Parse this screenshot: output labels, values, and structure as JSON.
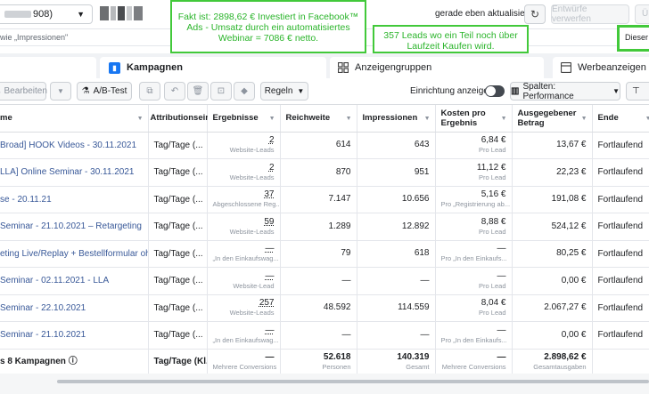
{
  "topbar": {
    "account_suffix": "908)",
    "status": "gerade eben aktualisiert",
    "discard_label": "Entwürfe verwerfen",
    "cut_label": "Ü"
  },
  "search": {
    "placeholder": "wie „Impressionen\""
  },
  "cut_right": "Dieser M",
  "annotations": {
    "a1": "Fakt ist: 2898,62 € Investiert in Facebook™ Ads - Umsatz durch ein automatisiertes Webinar = 7086 € netto.",
    "a2": "357 Leads wo ein Teil noch über Laufzeit Kaufen wird."
  },
  "tabs": {
    "campaigns": "Kampagnen",
    "adsets": "Anzeigengruppen",
    "ads": "Werbeanzeigen"
  },
  "toolbar": {
    "edit": "Bearbeiten",
    "ab_test": "A/B-Test",
    "rules": "Regeln",
    "setup": "Einrichtung anzeigen",
    "columns": "Spalten: Performance"
  },
  "colors": {
    "accent": "#1877f2",
    "annotation": "#42c93a",
    "link": "#385898"
  },
  "table": {
    "headers": {
      "name": "me",
      "attribution": "Attributionsein",
      "results": "Ergebnisse",
      "reach": "Reichweite",
      "impressions": "Impressionen",
      "cost": "Kosten pro Ergebnis",
      "spend": "Ausgegebener Betrag",
      "end": "Ende"
    },
    "rows": [
      {
        "name": "Broad] HOOK Videos - 30.11.2021",
        "attr": "Tag/Tage (...",
        "res": "2",
        "res_sub": "Website-Leads",
        "reach": "614",
        "impr": "643",
        "cost": "6,84 €",
        "cost_sub": "Pro Lead",
        "spend": "13,67 €",
        "end": "Fortlaufend"
      },
      {
        "name": "LLA] Online Seminar - 30.11.2021",
        "attr": "Tag/Tage (...",
        "res": "2",
        "res_sub": "Website-Leads",
        "reach": "870",
        "impr": "951",
        "cost": "11,12 €",
        "cost_sub": "Pro Lead",
        "spend": "22,23 €",
        "end": "Fortlaufend"
      },
      {
        "name": "se - 20.11.21",
        "attr": "Tag/Tage (...",
        "res": "37",
        "res_sub": "Abgeschlossene Reg...",
        "reach": "7.147",
        "impr": "10.656",
        "cost": "5,16 €",
        "cost_sub": "Pro „Registrierung ab...",
        "spend": "191,08 €",
        "end": "Fortlaufend"
      },
      {
        "name": "Seminar - 21.10.2021 – Retargeting",
        "attr": "Tag/Tage (...",
        "res": "59",
        "res_sub": "Website-Leads",
        "reach": "1.289",
        "impr": "12.892",
        "cost": "8,88 €",
        "cost_sub": "Pro Lead",
        "spend": "524,12 €",
        "end": "Fortlaufend"
      },
      {
        "name": "eting Live/Replay + Bestellformular ohne...",
        "attr": "Tag/Tage (...",
        "res": "—",
        "res_sub": "„In den Einkaufswag...",
        "reach": "79",
        "impr": "618",
        "cost": "—",
        "cost_sub": "Pro „In den Einkaufs...",
        "spend": "80,25 €",
        "end": "Fortlaufend"
      },
      {
        "name": "Seminar - 02.11.2021 - LLA",
        "attr": "Tag/Tage (...",
        "res": "—",
        "res_sub": "Website-Lead",
        "reach": "—",
        "impr": "—",
        "cost": "—",
        "cost_sub": "Pro Lead",
        "spend": "0,00 €",
        "end": "Fortlaufend"
      },
      {
        "name": "Seminar - 22.10.2021",
        "attr": "Tag/Tage (...",
        "res": "257",
        "res_sub": "Website-Leads",
        "reach": "48.592",
        "impr": "114.559",
        "cost": "8,04 €",
        "cost_sub": "Pro Lead",
        "spend": "2.067,27 €",
        "end": "Fortlaufend"
      },
      {
        "name": "Seminar - 21.10.2021",
        "attr": "Tag/Tage (...",
        "res": "—",
        "res_sub": "„In den Einkaufswag...",
        "reach": "—",
        "impr": "—",
        "cost": "—",
        "cost_sub": "Pro „In den Einkaufs...",
        "spend": "0,00 €",
        "end": "Fortlaufend"
      }
    ],
    "total": {
      "name": "s 8 Kampagnen",
      "attr": "Tag/Tage (Kl...",
      "res": "—",
      "res_sub": "Mehrere Conversions",
      "reach": "52.618",
      "reach_sub": "Personen",
      "impr": "140.319",
      "impr_sub": "Gesamt",
      "cost": "—",
      "cost_sub": "Mehrere Conversions",
      "spend": "2.898,62 €",
      "spend_sub": "Gesamtausgaben"
    }
  }
}
